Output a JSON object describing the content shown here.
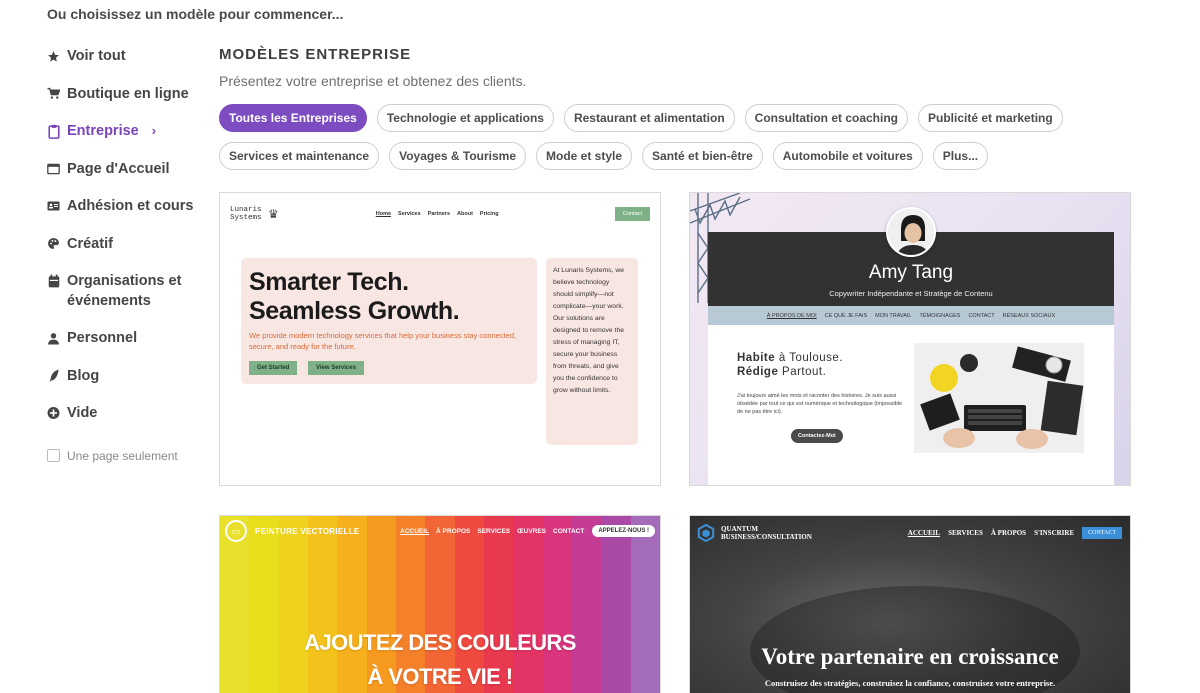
{
  "top_hint": "Ou choisissez un modèle pour commencer...",
  "sidebar": {
    "items": [
      {
        "label": "Voir tout",
        "icon": "star-icon"
      },
      {
        "label": "Boutique en ligne",
        "icon": "cart-icon"
      },
      {
        "label": "Entreprise",
        "icon": "clipboard-icon",
        "active": true
      },
      {
        "label": "Page d'Accueil",
        "icon": "browser-window-icon"
      },
      {
        "label": "Adhésion et cours",
        "icon": "id-card-icon"
      },
      {
        "label": "Créatif",
        "icon": "palette-icon"
      },
      {
        "label": "Organisations et événements",
        "icon": "calendar-icon"
      },
      {
        "label": "Personnel",
        "icon": "person-icon"
      },
      {
        "label": "Blog",
        "icon": "quill-icon"
      },
      {
        "label": "Vide",
        "icon": "plus-circle-icon"
      }
    ],
    "single_page_label": "Une page seulement",
    "active_color": "#7a45b8"
  },
  "section": {
    "title": "MODÈLES ENTREPRISE",
    "subtitle": "Présentez votre entreprise et obtenez des clients."
  },
  "chips": [
    {
      "label": "Toutes les Entreprises",
      "active": true
    },
    {
      "label": "Technologie et applications"
    },
    {
      "label": "Restaurant et alimentation"
    },
    {
      "label": "Consultation et coaching"
    },
    {
      "label": "Publicité et marketing"
    },
    {
      "label": "Services et maintenance"
    },
    {
      "label": "Voyages & Tourisme"
    },
    {
      "label": "Mode et style"
    },
    {
      "label": "Santé et bien-être"
    },
    {
      "label": "Automobile et voitures"
    },
    {
      "label": "Plus..."
    }
  ],
  "templates": {
    "lunaris": {
      "logo_line1": "Lunaris",
      "logo_line2": "Systems",
      "nav": [
        "Home",
        "Services",
        "Partners",
        "About",
        "Pricing"
      ],
      "contact": "Contact",
      "headline1": "Smarter Tech.",
      "headline2": "Seamless Growth.",
      "paragraph": "We provide modern technology services that help your business stay connected, secure, and ready for the future.",
      "btn_primary": "Get Started",
      "btn_secondary": "View Services",
      "side_text": "At Lunaris Systems, we believe technology should simplify—not complicate—your work. Our solutions are designed to remove the stress of managing IT, secure your business from threats, and give you the confidence to grow without limits."
    },
    "amy": {
      "name": "Amy Tang",
      "role": "Copywriter Indépendante et Stratège de Contenu",
      "menu": [
        "À PROPOS DE MOI",
        "CE QUE JE FAIS",
        "MON TRAVAIL",
        "TÉMOIGNAGES",
        "CONTACT",
        "RÉSEAUX SOCIAUX"
      ],
      "headline_b1": "Habite",
      "headline_r1": " à Toulouse.",
      "headline_b2": "Rédige",
      "headline_r2": " Partout.",
      "text": "J'ai toujours aimé les mots et raconter des histoires. Je suis aussi obsédée par tout ce qui est numérique et technologique (impossible de ne pas être ici).",
      "button": "Contactez-Moi"
    },
    "peinture": {
      "brand": "PEINTURE VECTORIELLE",
      "nav": [
        "ACCUEIL",
        "À PROPOS",
        "SERVICES",
        "ŒUVRES",
        "CONTACT"
      ],
      "call": "APPELEZ-NOUS !",
      "headline1": "AJOUTEZ DES COULEURS",
      "headline2": "À VOTRE VIE !",
      "stripe_colors": [
        "#e8e02a",
        "#eadd1c",
        "#efd21e",
        "#f3c31b",
        "#f6b01c",
        "#f79a20",
        "#f5802a",
        "#f26534",
        "#ee4a3f",
        "#e8394f",
        "#e33565",
        "#d9357c",
        "#c43c93",
        "#aa4aa6",
        "#a36bb8"
      ]
    },
    "quantum": {
      "brand_line1": "QUANTUM",
      "brand_line2": "BUSINESS/CONSULTATION",
      "nav": [
        "ACCUEIL",
        "SERVICES",
        "À PROPOS",
        "S'INSCRIRE"
      ],
      "contact": "CONTACT",
      "headline": "Votre partenaire en croissance",
      "subline": "Construisez des stratégies, construisez la confiance, construisez votre entreprise."
    }
  }
}
